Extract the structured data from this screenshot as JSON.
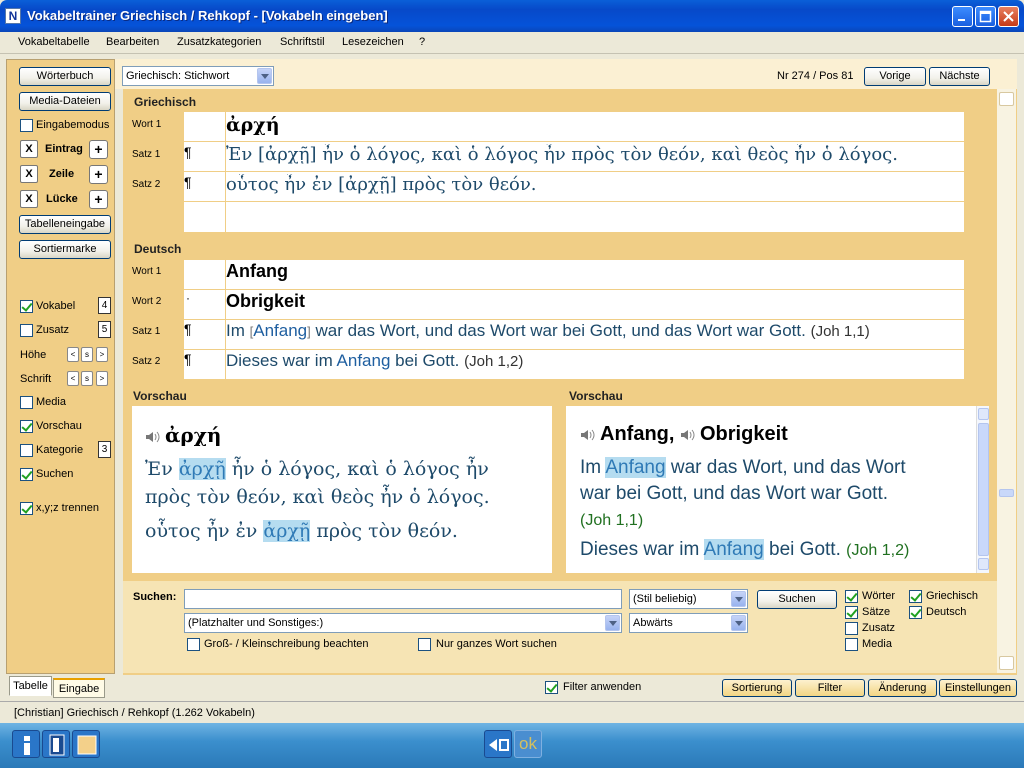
{
  "window": {
    "title": "Vokabeltrainer Griechisch / Rehkopf - [Vokabeln eingeben]",
    "app_icon": "N"
  },
  "menu": [
    "Vokabeltabelle",
    "Bearbeiten",
    "Zusatzkategorien",
    "Schriftstil",
    "Lesezeichen",
    "?"
  ],
  "sidebar": {
    "woerterbuch": "Wörterbuch",
    "media_dateien": "Media-Dateien",
    "eingabemodus": "Eingabemodus",
    "eintrag": "Eintrag",
    "zeile": "Zeile",
    "luecke": "Lücke",
    "x": "X",
    "plus": "+",
    "tabelleneingabe": "Tabelleneingabe",
    "sortiermarke": "Sortiermarke",
    "vokabel": "Vokabel",
    "vokabel_num": "4",
    "zusatz": "Zusatz",
    "zusatz_num": "5",
    "hoehe": "Höhe",
    "schrift": "Schrift",
    "small_lt": "<",
    "small_s": "s",
    "small_gt": ">",
    "media": "Media",
    "vorschau": "Vorschau",
    "kategorie": "Kategorie",
    "kategorie_num": "3",
    "suchen": "Suchen",
    "xyz": "x,y;z trennen"
  },
  "topbar": {
    "language_select": "Griechisch: Stichwort",
    "position": "Nr 274 / Pos 81",
    "vorige": "Vorige",
    "naechste": "Nächste"
  },
  "griechisch": {
    "header": "Griechisch",
    "labels": [
      "Wort 1",
      "Satz 1",
      "Satz 2"
    ],
    "pilcrow": "¶",
    "wort1": "ἀρχή",
    "satz1_pre": "Ἐν [",
    "satz1_hl": "ἀρχῇ",
    "satz1_post": "] ἦν ὁ λόγος, καὶ ὁ λόγος ἦν πρὸς τὸν θεόν, καὶ θεὸς ἦν ὁ λόγος.",
    "satz2_pre": "οὗτος ἦν ἐν [",
    "satz2_hl": "ἀρχῇ",
    "satz2_post": "] πρὸς τὸν θεόν."
  },
  "deutsch": {
    "header": "Deutsch",
    "labels": [
      "Wort 1",
      "Wort 2",
      "Satz 1",
      "Satz 2"
    ],
    "wort2_mark": "·",
    "wort1": "Anfang",
    "wort2": "Obrigkeit",
    "satz1_pre": "Im ",
    "satz1_br1": "[",
    "satz1_hl": "Anfang",
    "satz1_br2": "]",
    "satz1_post": " war das Wort, und das Wort war bei Gott, und das Wort war Gott.",
    "satz1_ref": "(Joh 1,1)",
    "satz2_pre": "Dieses war im ",
    "satz2_hl": "Anfang",
    "satz2_post": " bei Gott.",
    "satz2_ref": "(Joh 1,2)"
  },
  "vorschau_left": {
    "header": "Vorschau",
    "word": "ἀρχή",
    "s1_pre": "Ἐν ",
    "s1_hl": "ἀρχῇ",
    "s1_post": " ἦν ὁ λόγος, καὶ ὁ λόγος ἦν",
    "s1_line2": "πρὸς τὸν θεόν, καὶ θεὸς ἦν ὁ λόγος.",
    "s2_pre": "οὗτος ἦν ἐν ",
    "s2_hl": "ἀρχῇ",
    "s2_post": " πρὸς τὸν θεόν."
  },
  "vorschau_right": {
    "header": "Vorschau",
    "word1": "Anfang,",
    "word2": "Obrigkeit",
    "s1_pre": "Im ",
    "s1_hl": "Anfang",
    "s1_post": " war das Wort, und das Wort",
    "s1_line2": "war bei Gott, und das Wort war Gott.",
    "s1_ref": "(Joh 1,1)",
    "s2_pre": "Dieses war im ",
    "s2_hl": "Anfang",
    "s2_post": " bei Gott.",
    "s2_ref": "(Joh 1,2)"
  },
  "search": {
    "label": "Suchen:",
    "value": "",
    "stil": "(Stil beliebig)",
    "button": "Suchen",
    "platzhalter": "(Platzhalter und Sonstiges:)",
    "richtung": "Abwärts",
    "gross_klein": "Groß- / Kleinschreibung beachten",
    "ganzes_wort": "Nur ganzes Wort suchen",
    "woerter": "Wörter",
    "saetze": "Sätze",
    "zusatz": "Zusatz",
    "media": "Media",
    "griechisch": "Griechisch",
    "deutsch": "Deutsch"
  },
  "bottom": {
    "tab_tabelle": "Tabelle",
    "tab_eingabe": "Eingabe",
    "filter_anwenden": "Filter anwenden",
    "sortierung": "Sortierung",
    "filter": "Filter",
    "aenderung": "Änderung",
    "einstellungen": "Einstellungen"
  },
  "status": "[Christian]  Griechisch / Rehkopf  (1.262 Vokabeln)",
  "taskbar": {
    "ok": "ok"
  },
  "colors": {
    "panel": "#f0ce86",
    "highlight": "#b5dcf0",
    "text_dark": "#1e4a6a",
    "reference_green": "#207020"
  }
}
